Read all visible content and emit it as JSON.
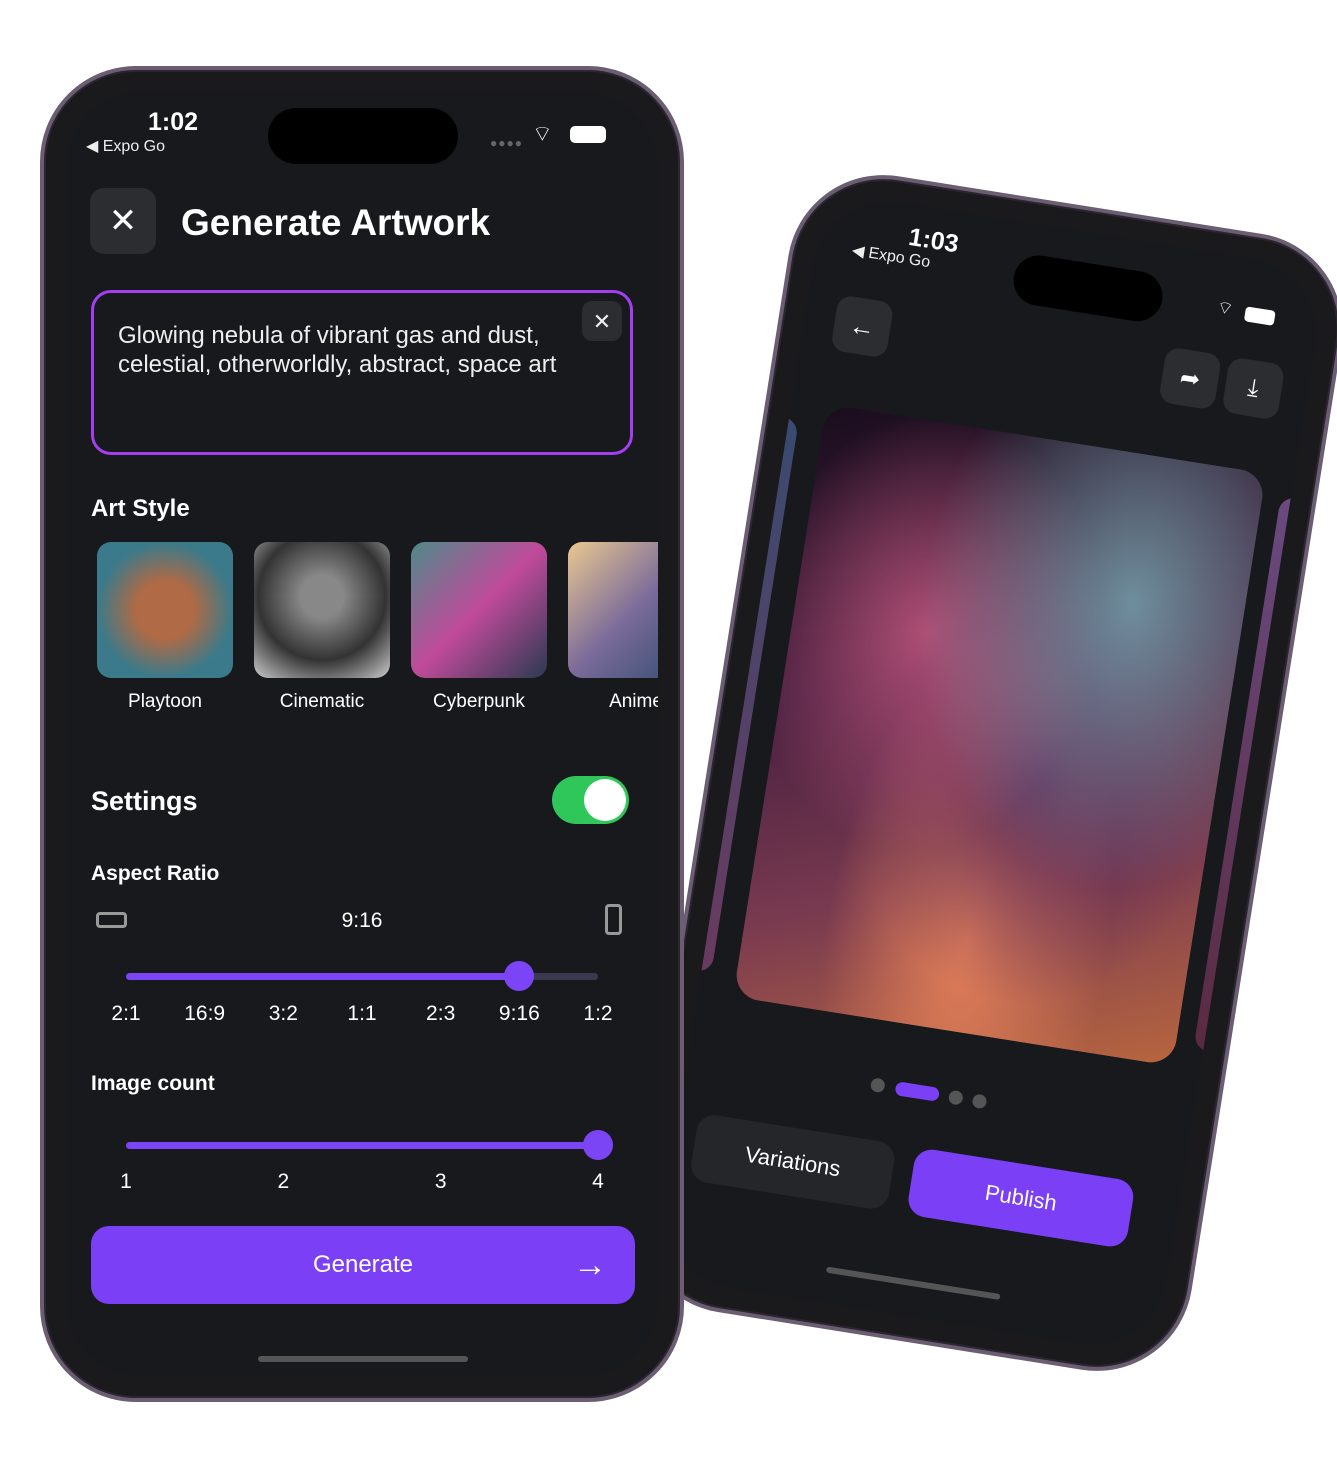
{
  "colors": {
    "accent": "#7b3ff6",
    "prompt_border": "#a43ff0",
    "toggle_on": "#30c75a",
    "background": "#17191c"
  },
  "phone1": {
    "status": {
      "time": "1:02",
      "back": "◀ Expo Go"
    },
    "close_icon": "close-icon",
    "title": "Generate Artwork",
    "prompt": "Glowing nebula of vibrant gas and dust, celestial, otherworldly, abstract, space art",
    "art_style": {
      "heading": "Art Style",
      "items": [
        {
          "label": "Playtoon"
        },
        {
          "label": "Cinematic"
        },
        {
          "label": "Cyberpunk"
        },
        {
          "label": "Anime"
        }
      ]
    },
    "settings": {
      "heading": "Settings",
      "enabled": true
    },
    "aspect_ratio": {
      "heading": "Aspect Ratio",
      "value": "9:16",
      "options": [
        "2:1",
        "16:9",
        "3:2",
        "1:1",
        "2:3",
        "9:16",
        "1:2"
      ],
      "selected_index": 5
    },
    "image_count": {
      "heading": "Image count",
      "options": [
        "1",
        "2",
        "3",
        "4"
      ],
      "value": 4
    },
    "generate_label": "Generate"
  },
  "phone2": {
    "status": {
      "time": "1:03",
      "back": "◀ Expo Go"
    },
    "carousel": {
      "pages": 4,
      "active": 1
    },
    "variations_label": "Variations",
    "publish_label": "Publish"
  }
}
